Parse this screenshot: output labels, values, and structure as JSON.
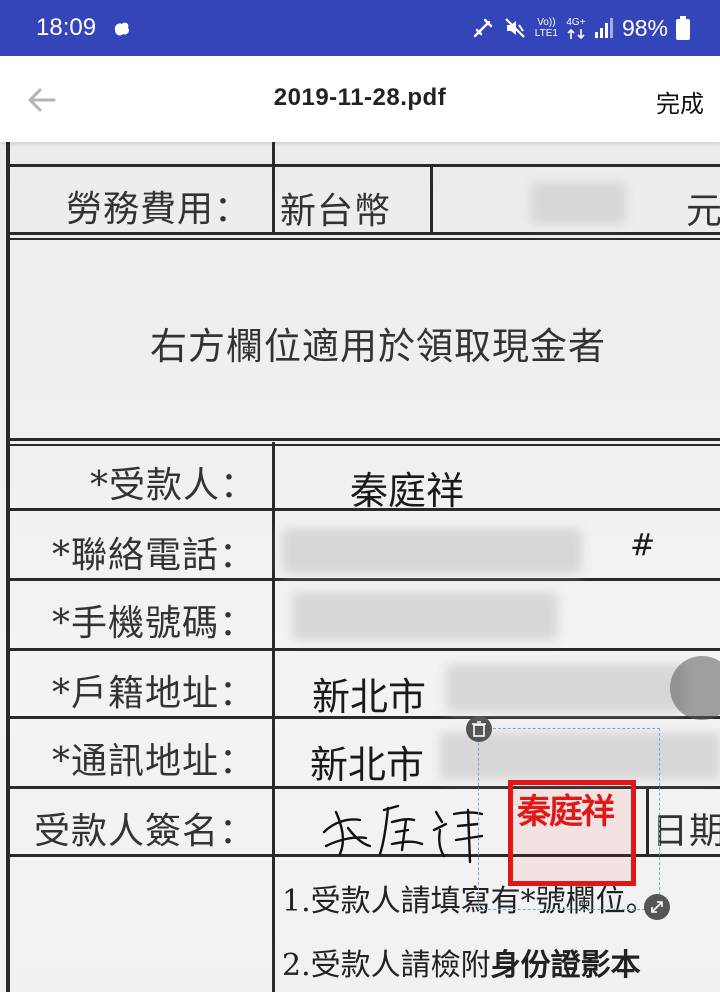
{
  "status_bar": {
    "time": "18:09",
    "network_top": "Vo))",
    "network_bottom": "LTE1",
    "network_type": "4G+",
    "battery": "98%"
  },
  "app_bar": {
    "title": "2019-11-28.pdf",
    "done_label": "完成",
    "back_icon": "arrow-left-icon"
  },
  "document": {
    "fee_label": "勞務費用：",
    "currency": "新台幣",
    "currency_unit": "元",
    "cash_notice": "右方欄位適用於領取現金者",
    "payee_label": "*受款人：",
    "payee_value": "秦庭祥",
    "phone_label": "*聯絡電話：",
    "phone_ext": "#",
    "mobile_label": "*手機號碼：",
    "household_label": "*戶籍地址：",
    "household_city": "新北市",
    "mailing_label": "*通訊地址：",
    "mailing_city": "新北市",
    "signature_label": "受款人簽名：",
    "date_label": "日期",
    "note1": "1.受款人請填寫有*號欄位。",
    "note2_prefix": "2.受款人請檢附",
    "note2_bold": "身份證影本",
    "seal_text": "秦庭祥"
  },
  "colors": {
    "status_bar": "#3345b8",
    "seal_red": "#e01818",
    "selection_dash": "#7fa6d8"
  }
}
